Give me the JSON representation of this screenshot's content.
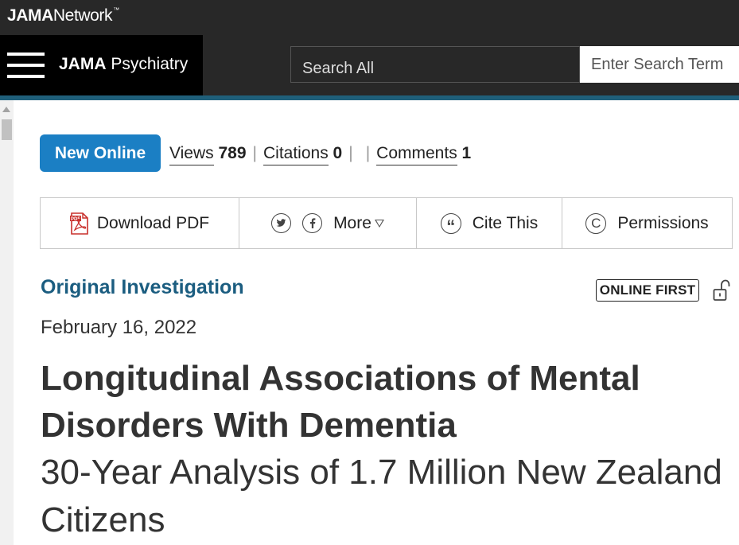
{
  "network": {
    "brand_bold": "JAMA",
    "brand_rest": "Network",
    "tm": "™"
  },
  "journal": {
    "name_bold": "JAMA",
    "name_rest": "Psychiatry"
  },
  "search": {
    "scope": "Search All",
    "placeholder": "Enter Search Term"
  },
  "colors": {
    "accent": "#1b7fc4",
    "section": "#1b5d80",
    "header_dark": "#282828"
  },
  "metrics": {
    "new_online_label": "New Online",
    "views_label": "Views",
    "views_count": "789",
    "citations_label": "Citations",
    "citations_count": "0",
    "comments_label": "Comments",
    "comments_count": "1",
    "separator": "|"
  },
  "toolbar": {
    "download_label": "Download PDF",
    "pdf_badge": "PDF",
    "more_label": "More",
    "cite_label": "Cite This",
    "cite_glyph": "“",
    "permissions_label": "Permissions",
    "permissions_glyph": "C"
  },
  "icons": [
    "menu-icon",
    "pdf-icon",
    "twitter-icon",
    "facebook-icon",
    "dropdown-triangle-icon",
    "quote-icon",
    "copyright-icon",
    "unlock-icon"
  ],
  "article": {
    "type": "Original Investigation",
    "badge": "ONLINE FIRST",
    "date": "February 16, 2022",
    "title": "Longitudinal Associations of Mental Disorders With Dementia",
    "subtitle": "30-Year Analysis of 1.7 Million New Zealand Citizens"
  }
}
